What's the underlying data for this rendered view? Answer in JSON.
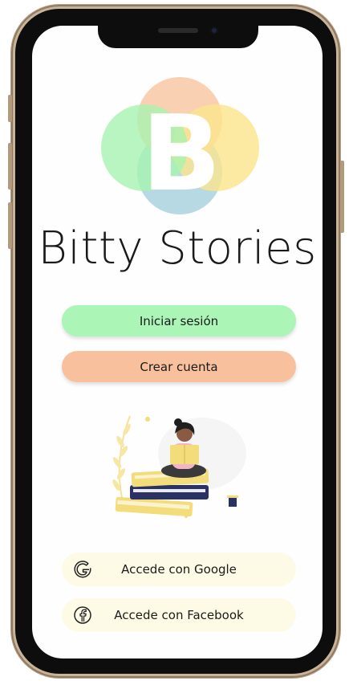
{
  "app": {
    "logo_letter": "B",
    "title": "Bitty Stories"
  },
  "buttons": {
    "login_label": "Iniciar sesión",
    "register_label": "Crear cuenta"
  },
  "social": {
    "google_label": "Accede con Google",
    "facebook_label": "Accede con Facebook"
  },
  "icons": {
    "logo": "bitty-stories-logo",
    "illustration": "reading-on-books-illustration",
    "google": "google-icon",
    "facebook": "facebook-icon"
  },
  "colors": {
    "login_button": "#abf5b7",
    "register_button": "#f8c09d",
    "social_button": "#fdfae6",
    "logo_orange": "#f9c8a5",
    "logo_green": "#a8f2b0",
    "logo_yellow": "#fbe58c",
    "logo_blue": "#a9d2df"
  }
}
